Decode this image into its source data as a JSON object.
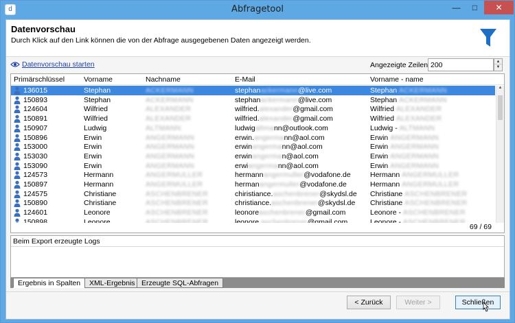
{
  "window": {
    "title": "Abfragetool",
    "min_label": "—",
    "max_label": "□",
    "close_label": "✕"
  },
  "header": {
    "title": "Datenvorschau",
    "subtitle": "Durch Klick auf den Link können die von der Abfrage ausgegebenen Daten angezeigt werden.",
    "icon": "filter-icon"
  },
  "preview": {
    "link_label": "Datenvorschau starten",
    "rows_label": "Angezeigte Zeilen:",
    "rows_value": "200",
    "spinner_up": "▲",
    "spinner_down": "▼"
  },
  "grid": {
    "columns": [
      "Primärschlüssel",
      "Vorname",
      "Nachname",
      "E-Mail",
      "Vorname - name"
    ],
    "rows": [
      {
        "id": "136015",
        "first": "Stephan",
        "last": "ACKERMANN",
        "email_a": "stephan",
        "email_b": "ackermann",
        "email_c": "@live.com",
        "full_a": "Stephan",
        "full_b": "ACKERMANN",
        "selected": true
      },
      {
        "id": "150893",
        "first": "Stephan",
        "last": "ACKERMANN",
        "email_a": "stephan",
        "email_b": "ackermann",
        "email_c": "@live.com",
        "full_a": "Stephan",
        "full_b": "ACKERMANN"
      },
      {
        "id": "124604",
        "first": "Wilfried",
        "last": "ALEXANDER",
        "email_a": "wilfried.",
        "email_b": "alexander",
        "email_c": "@gmail.com",
        "full_a": "Wilfried",
        "full_b": "ALEXANDER"
      },
      {
        "id": "150891",
        "first": "Wilfried",
        "last": "ALEXANDER",
        "email_a": "wilfried.",
        "email_b": "alexander",
        "email_c": "@gmail.com",
        "full_a": "Wilfried",
        "full_b": "ALEXANDER"
      },
      {
        "id": "150907",
        "first": "Ludwig",
        "last": "ALTMANN",
        "email_a": "ludwig",
        "email_b": "altma",
        "email_c": "nn@outlook.com",
        "full_a": "Ludwig -",
        "full_b": "ALTMANN"
      },
      {
        "id": "150896",
        "first": "Erwin",
        "last": "ANGERMANN",
        "email_a": "erwin.",
        "email_b": "angerma",
        "email_c": "nn@aol.com",
        "full_a": "Erwin",
        "full_b": "ANGERMANN"
      },
      {
        "id": "153000",
        "first": "Erwin",
        "last": "ANGERMANN",
        "email_a": "erwin",
        "email_b": "angerma",
        "email_c": "nn@aol.com",
        "full_a": "Erwin",
        "full_b": "ANGERMANN"
      },
      {
        "id": "153030",
        "first": "Erwin",
        "last": "ANGERMANN",
        "email_a": "erwin",
        "email_b": "angerma",
        "email_c": "n@aol.com",
        "full_a": "Erwin",
        "full_b": "ANGERMANN"
      },
      {
        "id": "153090",
        "first": "Erwin",
        "last": "ANGERMANN",
        "email_a": "erwi",
        "email_b": "angerma",
        "email_c": "nn@aol.com",
        "full_a": "Erwin",
        "full_b": "ANGERMANN"
      },
      {
        "id": "124573",
        "first": "Hermann",
        "last": "ANGERMULLER",
        "email_a": "hermann",
        "email_b": "angermuller",
        "email_c": "@vodafone.de",
        "full_a": "Hermann",
        "full_b": "ANGERMULLER"
      },
      {
        "id": "150897",
        "first": "Hermann",
        "last": "ANGERMULLER",
        "email_a": "herman",
        "email_b": "angermuller",
        "email_c": "@vodafone.de",
        "full_a": "Hermann",
        "full_b": "ANGERMULLER"
      },
      {
        "id": "124575",
        "first": "Christiane",
        "last": "ASCHENBRENER",
        "email_a": "chiristiance.",
        "email_b": "aschenbrener",
        "email_c": "@skydsl.de",
        "full_a": "Christiane",
        "full_b": "ASCHENBRENER"
      },
      {
        "id": "150890",
        "first": "Christiane",
        "last": "ASCHENBRENER",
        "email_a": "christiance.",
        "email_b": "aschenbrener",
        "email_c": "@skydsl.de",
        "full_a": "Christiane",
        "full_b": "ASCHENBRENER"
      },
      {
        "id": "124601",
        "first": "Leonore",
        "last": "ASCHENBRENER",
        "email_a": "leonore",
        "email_b": "aschenbrener",
        "email_c": "@gmail.com",
        "full_a": "Leonore -",
        "full_b": "ASCHENBRENER"
      },
      {
        "id": "150898",
        "first": "Leonore",
        "last": "ASCHENBRENER",
        "email_a": "leonore.",
        "email_b": "aschenbrener",
        "email_c": "@gmail.com",
        "full_a": "Leonore -",
        "full_b": "ASCHENBRENER"
      }
    ],
    "row_count": "69 / 69"
  },
  "logs": {
    "title": "Beim Export erzeugte Logs"
  },
  "tabs": [
    "Ergebnis in Spalten",
    "XML-Ergebnis",
    "Erzeugte SQL-Abfragen"
  ],
  "buttons": {
    "back": "< Zurück",
    "next": "Weiter >",
    "close": "Schließen"
  },
  "colors": {
    "accent": "#5ea8e4",
    "selection": "#3c87e0",
    "link": "#1d40b0",
    "filter_icon": "#1f6fc4"
  }
}
